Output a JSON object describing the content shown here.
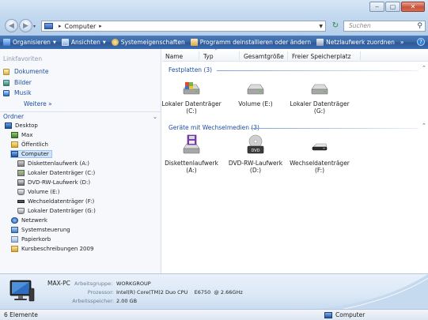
{
  "window": {
    "title_buttons": {
      "minimize": "‒",
      "maximize": "▢",
      "close": "✕"
    },
    "address": {
      "crumb": "Computer",
      "sep_before": "▸",
      "sep_after": "▸"
    },
    "search_placeholder": "Suchen"
  },
  "toolbar": {
    "items": [
      {
        "label": "Organisieren",
        "icon": "organize-icon",
        "dropdown": true
      },
      {
        "label": "Ansichten",
        "icon": "views-icon",
        "dropdown": true
      },
      {
        "label": "Systemeigenschaften",
        "icon": "system-properties-icon",
        "dropdown": false
      },
      {
        "label": "Programm deinstallieren oder ändern",
        "icon": "uninstall-icon",
        "dropdown": false
      },
      {
        "label": "Netzlaufwerk zuordnen",
        "icon": "map-network-drive-icon",
        "dropdown": false
      }
    ],
    "more": "»",
    "help": "?"
  },
  "sidebar": {
    "favorites_heading": "Linkfavoriten",
    "favorites": [
      {
        "label": "Dokumente",
        "icon": "documents-icon"
      },
      {
        "label": "Bilder",
        "icon": "pictures-icon"
      },
      {
        "label": "Musik",
        "icon": "music-icon"
      }
    ],
    "more_label": "Weitere »",
    "folders_heading": "Ordner",
    "tree": [
      {
        "label": "Desktop",
        "icon": "desktop-icon",
        "level": 0
      },
      {
        "label": "Max",
        "icon": "user-folder-icon",
        "level": 1
      },
      {
        "label": "Öffentlich",
        "icon": "folder-icon",
        "level": 1
      },
      {
        "label": "Computer",
        "icon": "computer-icon",
        "level": 1,
        "selected": true
      },
      {
        "label": "Diskettenlaufwerk (A:)",
        "icon": "floppy-drive-icon",
        "level": 2
      },
      {
        "label": "Lokaler Datenträger (C:)",
        "icon": "system-drive-icon",
        "level": 2
      },
      {
        "label": "DVD-RW-Laufwerk (D:)",
        "icon": "dvd-drive-icon",
        "level": 2
      },
      {
        "label": "Volume (E:)",
        "icon": "hard-drive-icon",
        "level": 2
      },
      {
        "label": "Wechseldatenträger (F:)",
        "icon": "removable-drive-icon",
        "level": 2
      },
      {
        "label": "Lokaler Datenträger (G:)",
        "icon": "hard-drive-icon",
        "level": 2
      },
      {
        "label": "Netzwerk",
        "icon": "network-icon",
        "level": 1
      },
      {
        "label": "Systemsteuerung",
        "icon": "control-panel-icon",
        "level": 1
      },
      {
        "label": "Papierkorb",
        "icon": "recycle-bin-icon",
        "level": 1
      },
      {
        "label": "Kursbeschreibungen 2009",
        "icon": "folder-icon",
        "level": 1
      }
    ]
  },
  "columns": [
    "Name",
    "Typ",
    "Gesamtgröße",
    "Freier Speicherplatz"
  ],
  "groups": [
    {
      "title": "Festplatten (3)",
      "items": [
        {
          "line1": "Lokaler Datenträger",
          "line2": "(C:)",
          "icon": "system-drive-icon"
        },
        {
          "line1": "Volume (E:)",
          "line2": "",
          "icon": "hard-drive-icon"
        },
        {
          "line1": "Lokaler Datenträger",
          "line2": "(G:)",
          "icon": "hard-drive-icon"
        }
      ]
    },
    {
      "title": "Geräte mit Wechselmedien (3)",
      "items": [
        {
          "line1": "Diskettenlaufwerk",
          "line2": "(A:)",
          "icon": "floppy-drive-icon"
        },
        {
          "line1": "DVD-RW-Laufwerk",
          "line2": "(D:)",
          "icon": "dvd-drive-icon"
        },
        {
          "line1": "Wechseldatenträger",
          "line2": "(F:)",
          "icon": "removable-drive-icon"
        }
      ]
    }
  ],
  "details": {
    "pc_name": "MAX-PC",
    "workgroup_label": "Arbeitsgruppe:",
    "workgroup_value": "WORKGROUP",
    "processor_label": "Prozessor:",
    "processor_value": "Intel(R) Core(TM)2 Duo CPU    E6750  @ 2.66GHz",
    "memory_label": "Arbeitsspeicher:",
    "memory_value": "2.00 GB"
  },
  "status": {
    "count": "6 Elemente",
    "location": "Computer"
  },
  "colors": {
    "toolbar": "#3a68a8",
    "link": "#1e4e9e",
    "selection": "#cfe3fb"
  }
}
